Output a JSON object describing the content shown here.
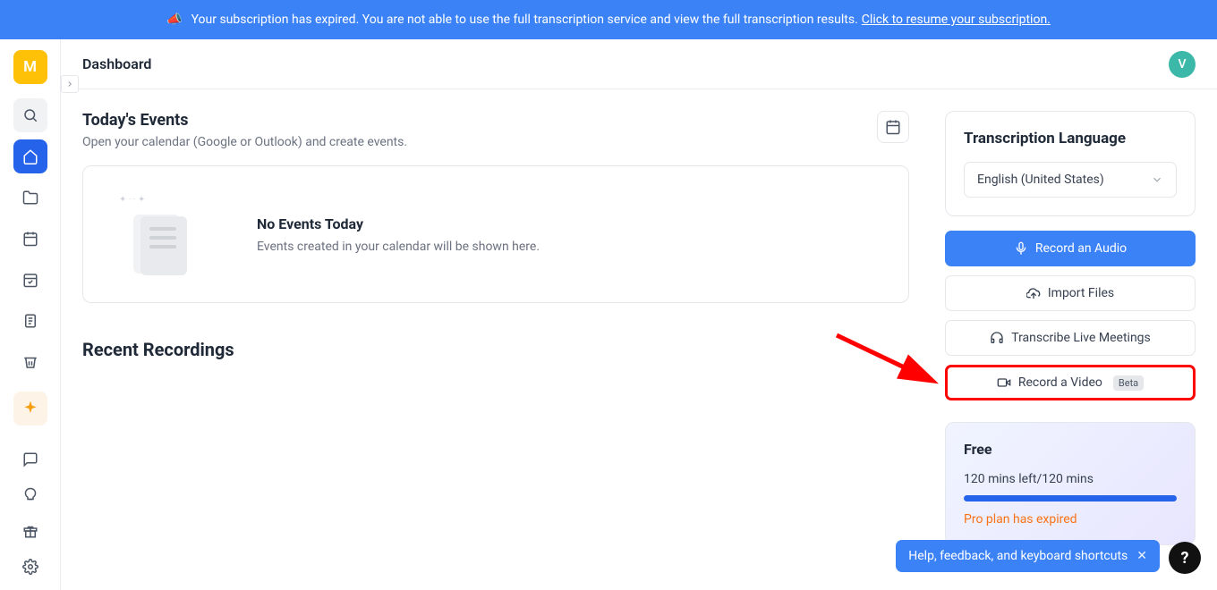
{
  "banner": {
    "icon": "📣",
    "text": "Your subscription has expired. You are not able to use the full transcription service and view the full transcription results.",
    "link_text": "Click to resume your subscription."
  },
  "sidebar": {
    "logo_letter": "M"
  },
  "header": {
    "title": "Dashboard",
    "avatar_initial": "V"
  },
  "events": {
    "title": "Today's Events",
    "subtitle": "Open your calendar (Google or Outlook) and create events.",
    "empty_title": "No Events Today",
    "empty_sub": "Events created in your calendar will be shown here."
  },
  "recent": {
    "title": "Recent Recordings"
  },
  "lang": {
    "title": "Transcription Language",
    "selected": "English (United States)"
  },
  "actions": {
    "record_audio": "Record an Audio",
    "import_files": "Import Files",
    "transcribe_live": "Transcribe Live Meetings",
    "record_video": "Record a Video",
    "beta": "Beta"
  },
  "plan": {
    "name": "Free",
    "quota": "120 mins left/120 mins",
    "progress_pct": 100,
    "expired_text": "Pro plan has expired"
  },
  "help": {
    "text": "Help, feedback, and keyboard shortcuts",
    "fab": "?"
  }
}
